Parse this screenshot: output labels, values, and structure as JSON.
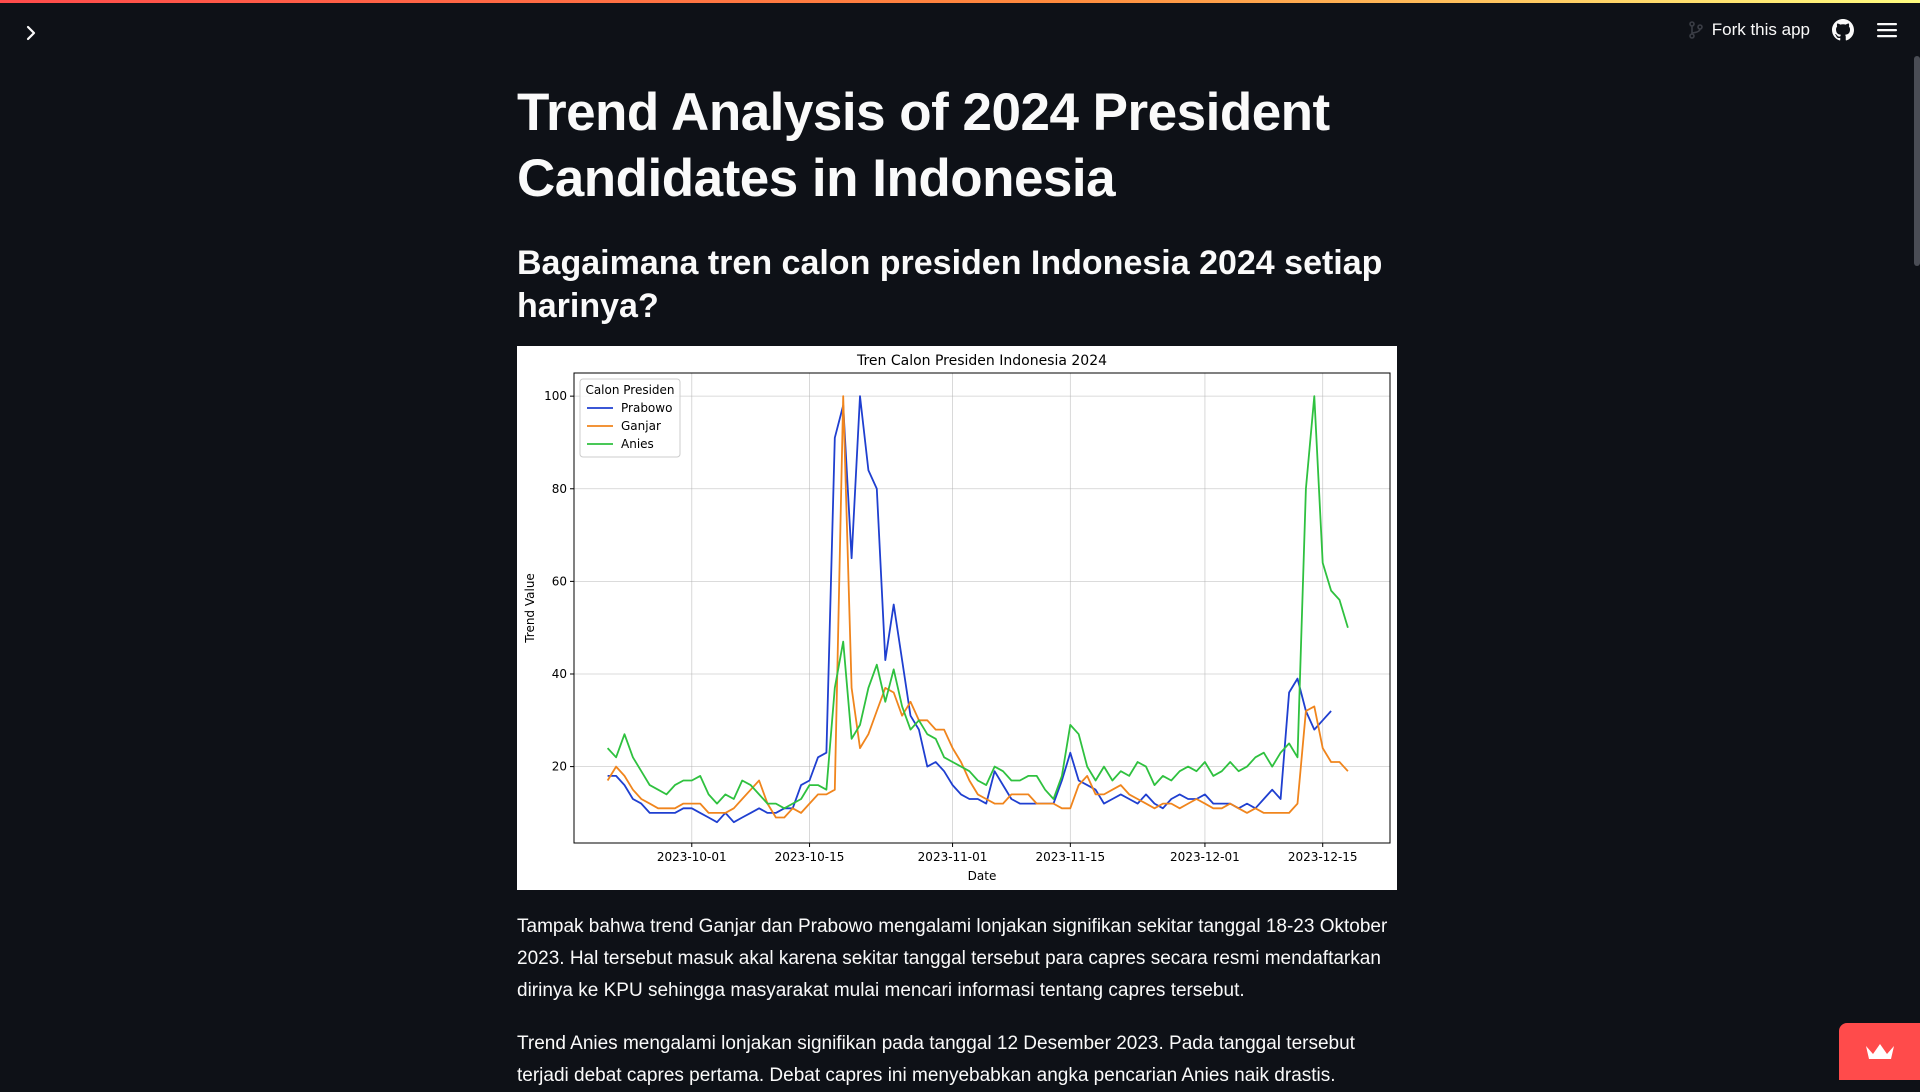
{
  "header": {
    "fork_label": "Fork this app",
    "icons": [
      "chevron-right-icon",
      "fork-icon",
      "github-icon",
      "hamburger-menu-icon",
      "crown-icon"
    ]
  },
  "colors": {
    "background": "#0e1117",
    "text": "#fafafa",
    "accent": "#ff4b4b"
  },
  "main": {
    "title": "Trend Analysis of 2024 President Candidates in Indonesia",
    "subtitle": "Bagaimana tren calon presiden Indonesia 2024 setiap harinya?",
    "paragraph_1": "Tampak bahwa trend Ganjar dan Prabowo mengalami lonjakan signifikan sekitar tanggal 18-23 Oktober 2023. Hal tersebut masuk akal karena sekitar tanggal tersebut para capres secara resmi mendaftarkan dirinya ke KPU sehingga masyarakat mulai mencari informasi tentang capres tersebut.",
    "paragraph_2": "Trend Anies mengalami lonjakan signifikan pada tanggal 12 Desember 2023. Pada tanggal tersebut terjadi debat capres pertama. Debat capres ini menyebabkan angka pencarian Anies naik drastis."
  },
  "chart_data": {
    "type": "line",
    "title": "Tren Calon Presiden Indonesia 2024",
    "xlabel": "Date",
    "ylabel": "Trend Value",
    "legend_title": "Calon Presiden",
    "legend_position": "top-left",
    "grid": true,
    "x_start": "2023-09-21",
    "x_end": "2023-12-17",
    "xlim": [
      "2023-09-17",
      "2023-12-23"
    ],
    "ylim": [
      3.5,
      105
    ],
    "x_ticks": [
      "2023-10-01",
      "2023-10-15",
      "2023-11-01",
      "2023-11-15",
      "2023-12-01",
      "2023-12-15"
    ],
    "y_ticks": [
      20,
      40,
      60,
      80,
      100
    ],
    "series": [
      {
        "name": "Prabowo",
        "color": "#1f3fd0",
        "values": [
          18,
          18,
          16,
          13,
          12,
          10,
          10,
          10,
          10,
          11,
          11,
          10,
          9,
          8,
          10,
          8,
          9,
          10,
          11,
          10,
          10,
          11,
          11,
          16,
          17,
          22,
          23,
          91,
          98,
          65,
          100,
          84,
          80,
          43,
          55,
          43,
          31,
          28,
          20,
          21,
          19,
          16,
          14,
          13,
          13,
          12,
          19,
          16,
          13,
          12,
          12,
          12,
          12,
          12,
          17,
          23,
          17,
          16,
          15,
          12,
          13,
          14,
          13,
          12,
          14,
          12,
          11,
          13,
          14,
          13,
          13,
          14,
          12,
          12,
          12,
          11,
          12,
          11,
          13,
          15,
          13,
          36,
          39,
          32,
          28,
          30,
          32
        ]
      },
      {
        "name": "Ganjar",
        "color": "#f0851d",
        "values": [
          17,
          20,
          18,
          15,
          13,
          12,
          11,
          11,
          11,
          12,
          12,
          12,
          10,
          10,
          10,
          11,
          13,
          15,
          17,
          12,
          9,
          9,
          11,
          10,
          12,
          14,
          14,
          15,
          100,
          37,
          24,
          27,
          32,
          37,
          36,
          31,
          34,
          30,
          30,
          28,
          28,
          24,
          21,
          17,
          14,
          13,
          12,
          12,
          14,
          14,
          14,
          12,
          12,
          12,
          11,
          11,
          16,
          18,
          14,
          14,
          15,
          16,
          14,
          13,
          12,
          11,
          12,
          12,
          11,
          12,
          13,
          12,
          11,
          11,
          12,
          11,
          10,
          11,
          10,
          10,
          10,
          10,
          12,
          32,
          33,
          24,
          21,
          21,
          19
        ]
      },
      {
        "name": "Anies",
        "color": "#2fc13f",
        "values": [
          24,
          22,
          27,
          22,
          19,
          16,
          15,
          14,
          16,
          17,
          17,
          18,
          14,
          12,
          14,
          13,
          17,
          16,
          14,
          12,
          12,
          11,
          12,
          13,
          16,
          16,
          15,
          37,
          47,
          26,
          29,
          37,
          42,
          34,
          41,
          33,
          28,
          30,
          27,
          26,
          22,
          21,
          20,
          19,
          17,
          16,
          20,
          19,
          17,
          17,
          18,
          18,
          15,
          13,
          18,
          29,
          27,
          20,
          17,
          20,
          17,
          19,
          18,
          21,
          20,
          16,
          18,
          17,
          19,
          20,
          19,
          21,
          18,
          19,
          21,
          19,
          20,
          22,
          23,
          20,
          23,
          25,
          22,
          80,
          100,
          64,
          58,
          56,
          50
        ]
      }
    ]
  }
}
